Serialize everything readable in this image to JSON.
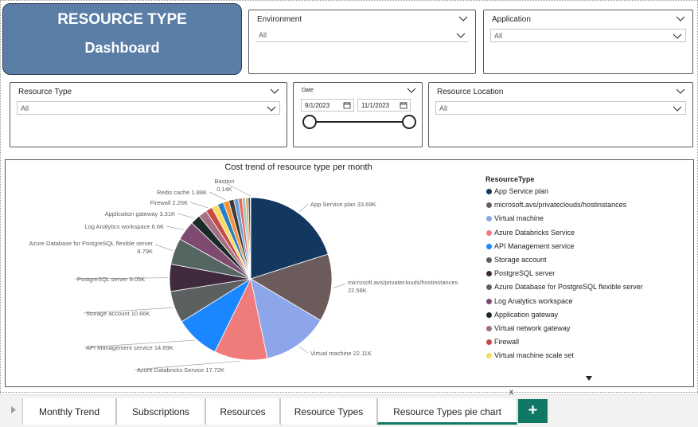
{
  "title_card": {
    "line1": "RESOURCE TYPE",
    "line2": "Dashboard"
  },
  "slicers": {
    "environment": {
      "label": "Environment",
      "value": "All"
    },
    "application": {
      "label": "Application",
      "value": "All"
    },
    "resource_type": {
      "label": "Resource Type",
      "value": "All"
    },
    "date": {
      "label": "Date",
      "start": "9/1/2023",
      "end": "11/1/2023"
    },
    "resource_location": {
      "label": "Resource Location",
      "value": "All"
    }
  },
  "chart_data": {
    "type": "pie",
    "title": "Cost trend of resource type per month",
    "legend_title": "ResourceType",
    "slices": [
      {
        "name": "App Service plan",
        "value": 33690,
        "label": "App Service plan 33.69K",
        "color": "#12385f"
      },
      {
        "name": "microsoft.avs/privateclouds/hostinstances",
        "value": 22580,
        "label": "microsoft.avs/privateclouds/hostinstances\n22.58K",
        "color": "#6b5c5b"
      },
      {
        "name": "Virtual machine",
        "value": 22110,
        "label": "Virtual machine 22.11K",
        "color": "#8da6ea"
      },
      {
        "name": "Azure Databricks Service",
        "value": 17720,
        "label": "Azure Databricks Service 17.72K",
        "color": "#f07b7b"
      },
      {
        "name": "API Management service",
        "value": 14890,
        "label": "API Management service 14.89K",
        "color": "#1a86ff"
      },
      {
        "name": "Storage account",
        "value": 10660,
        "label": "Storage account 10.66K",
        "color": "#5c6061"
      },
      {
        "name": "PostgreSQL server",
        "value": 9050,
        "label": "PostgreSQL server 9.05K",
        "color": "#3f2a3e"
      },
      {
        "name": "Azure Database for PostgreSQL flexible server",
        "value": 8790,
        "label": "Azure Database for PostgreSQL flexible server\n8.79K",
        "color": "#556562"
      },
      {
        "name": "Log Analytics workspace",
        "value": 6600,
        "label": "Log Analytics workspace 6.6K",
        "color": "#7e4a6f"
      },
      {
        "name": "Application gateway",
        "value": 3310,
        "label": "Application gateway 3.31K",
        "color": "#1a2a27"
      },
      {
        "name": "Virtual network gateway",
        "value": 2800,
        "label": "",
        "color": "#a46f82"
      },
      {
        "name": "Firewall",
        "value": 2260,
        "label": "Firewall 2.26K",
        "color": "#c64a47"
      },
      {
        "name": "Virtual machine scale set",
        "value": 2100,
        "label": "",
        "color": "#f8dc5f"
      },
      {
        "name": "",
        "value": 2000,
        "label": "",
        "color": "#2a7dc1"
      },
      {
        "name": "Redis cache",
        "value": 1880,
        "label": "Redis cache 1.88K",
        "color": "#f5923b"
      },
      {
        "name": "",
        "value": 1700,
        "label": "",
        "color": "#3b3b3b"
      },
      {
        "name": "",
        "value": 1500,
        "label": "",
        "color": "#6a9fd8"
      },
      {
        "name": "",
        "value": 1300,
        "label": "",
        "color": "#e86d5a"
      },
      {
        "name": "",
        "value": 1100,
        "label": "",
        "color": "#9ec8c4"
      },
      {
        "name": "",
        "value": 900,
        "label": "",
        "color": "#d8a85c"
      },
      {
        "name": "",
        "value": 700,
        "label": "",
        "color": "#5a4d8c"
      },
      {
        "name": "Bastion",
        "value": 140,
        "label": "Bastion\n0.14K",
        "color": "#a3c0e0"
      }
    ],
    "legend": [
      {
        "name": "App Service plan",
        "color": "#12385f"
      },
      {
        "name": "microsoft.avs/privateclouds/hostinstances",
        "color": "#6b5c5b"
      },
      {
        "name": "Virtual machine",
        "color": "#8da6ea"
      },
      {
        "name": "Azure Databricks Service",
        "color": "#f07b7b"
      },
      {
        "name": "API Management service",
        "color": "#1a86ff"
      },
      {
        "name": "Storage account",
        "color": "#5c6061"
      },
      {
        "name": "PostgreSQL server",
        "color": "#3f2a3e"
      },
      {
        "name": "Azure Database for PostgreSQL flexible server",
        "color": "#556562"
      },
      {
        "name": "Log Analytics workspace",
        "color": "#7e4a6f"
      },
      {
        "name": "Application gateway",
        "color": "#1a2a27"
      },
      {
        "name": "Virtual network gateway",
        "color": "#a46f82"
      },
      {
        "name": "Firewall",
        "color": "#c64a47"
      },
      {
        "name": "Virtual machine scale set",
        "color": "#f8dc5f"
      }
    ]
  },
  "tabs": [
    {
      "label": "Monthly Trend",
      "active": false
    },
    {
      "label": "Subscriptions",
      "active": false
    },
    {
      "label": "Resources",
      "active": false
    },
    {
      "label": "Resource Types",
      "active": false
    },
    {
      "label": "Resource Types pie chart",
      "active": true
    }
  ],
  "tab_close": "x",
  "add_tab_label": "+",
  "icons": {
    "chevron": "chevron-down-icon",
    "calendar": "calendar-icon",
    "scroll": "scroll-down-icon",
    "nav": "chevron-right-icon"
  },
  "colors": {
    "title_card": "#5b7ea7",
    "active_tab": "#117865"
  }
}
